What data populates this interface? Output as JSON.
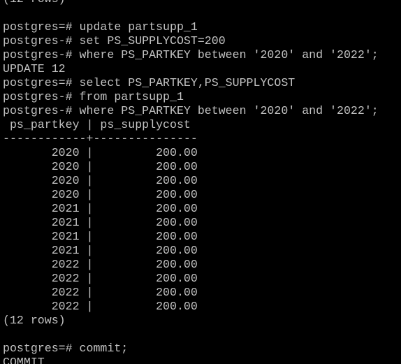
{
  "terminal": {
    "prompt": "postgres=#",
    "cont_prompt": "postgres-#",
    "lines": [
      {
        "kind": "output",
        "text": "(12 rows)"
      },
      {
        "kind": "output",
        "text": ""
      },
      {
        "kind": "command",
        "prompt": "postgres=#",
        "text": " update partsupp_1"
      },
      {
        "kind": "command",
        "prompt": "postgres-#",
        "text": " set PS_SUPPLYCOST=200"
      },
      {
        "kind": "command",
        "prompt": "postgres-#",
        "text": " where PS_PARTKEY between '2020' and '2022';"
      },
      {
        "kind": "output",
        "text": "UPDATE 12"
      },
      {
        "kind": "command",
        "prompt": "postgres=#",
        "text": " select PS_PARTKEY,PS_SUPPLYCOST"
      },
      {
        "kind": "command",
        "prompt": "postgres-#",
        "text": " from partsupp_1"
      },
      {
        "kind": "command",
        "prompt": "postgres-#",
        "text": " where PS_PARTKEY between '2020' and '2022';"
      }
    ],
    "result": {
      "header": " ps_partkey | ps_supplycost",
      "separator": "------------+---------------",
      "columns": [
        "ps_partkey",
        "ps_supplycost"
      ],
      "rows": [
        [
          "2020",
          "200.00"
        ],
        [
          "2020",
          "200.00"
        ],
        [
          "2020",
          "200.00"
        ],
        [
          "2020",
          "200.00"
        ],
        [
          "2021",
          "200.00"
        ],
        [
          "2021",
          "200.00"
        ],
        [
          "2021",
          "200.00"
        ],
        [
          "2021",
          "200.00"
        ],
        [
          "2022",
          "200.00"
        ],
        [
          "2022",
          "200.00"
        ],
        [
          "2022",
          "200.00"
        ],
        [
          "2022",
          "200.00"
        ]
      ],
      "footer": "(12 rows)"
    },
    "tail": [
      {
        "kind": "output",
        "text": ""
      },
      {
        "kind": "command",
        "prompt": "postgres=#",
        "text": " commit;"
      },
      {
        "kind": "output",
        "text": "COMMIT"
      }
    ]
  }
}
